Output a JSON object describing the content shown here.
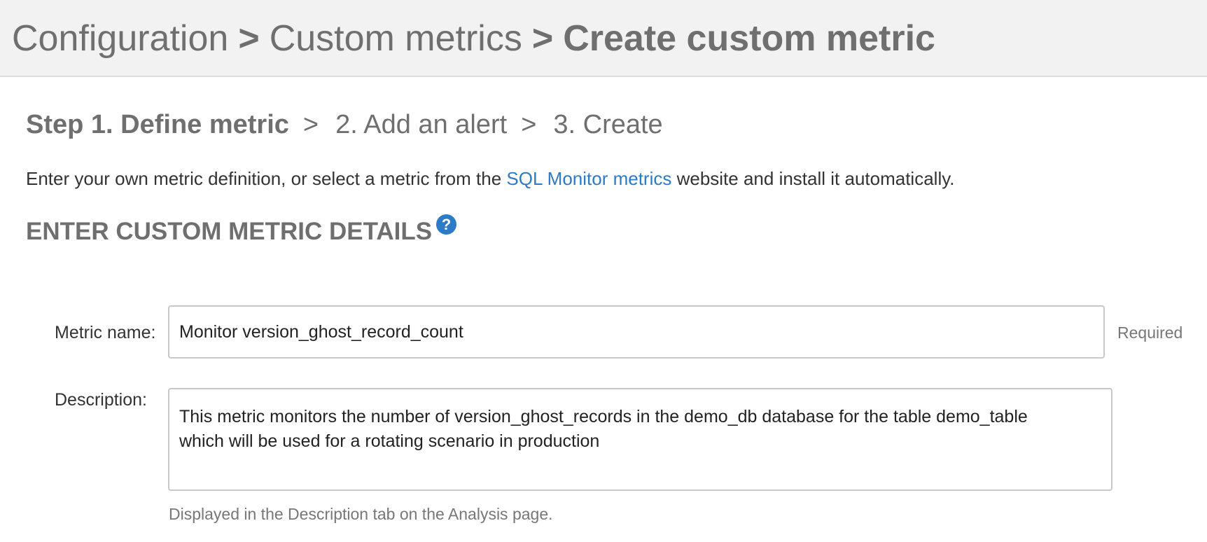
{
  "breadcrumb": {
    "items": [
      "Configuration",
      "Custom metrics",
      "Create custom metric"
    ],
    "separator": ">"
  },
  "steps": {
    "step1": "Step 1. Define metric",
    "step2": "2. Add an alert",
    "step3": "3. Create",
    "separator": ">"
  },
  "intro": {
    "before": "Enter your own metric definition, or select a metric from the ",
    "link": "SQL Monitor metrics",
    "after": " website and install it automatically."
  },
  "section": {
    "title": "ENTER CUSTOM METRIC DETAILS",
    "help_icon": "?"
  },
  "form": {
    "metric_name_label": "Metric name:",
    "metric_name_value": "Monitor version_ghost_record_count",
    "required_label": "Required",
    "description_label": "Description:",
    "description_value": "This metric monitors the number of version_ghost_records in the demo_db database for the table demo_table\nwhich will be used for a rotating scenario in production",
    "description_hint": "Displayed in the Description tab on the Analysis page."
  },
  "colors": {
    "link": "#2b7bc9",
    "header_bg": "#f2f2f2",
    "heading_text": "#6f6f6f"
  },
  "icons": {
    "help": "help-icon"
  }
}
